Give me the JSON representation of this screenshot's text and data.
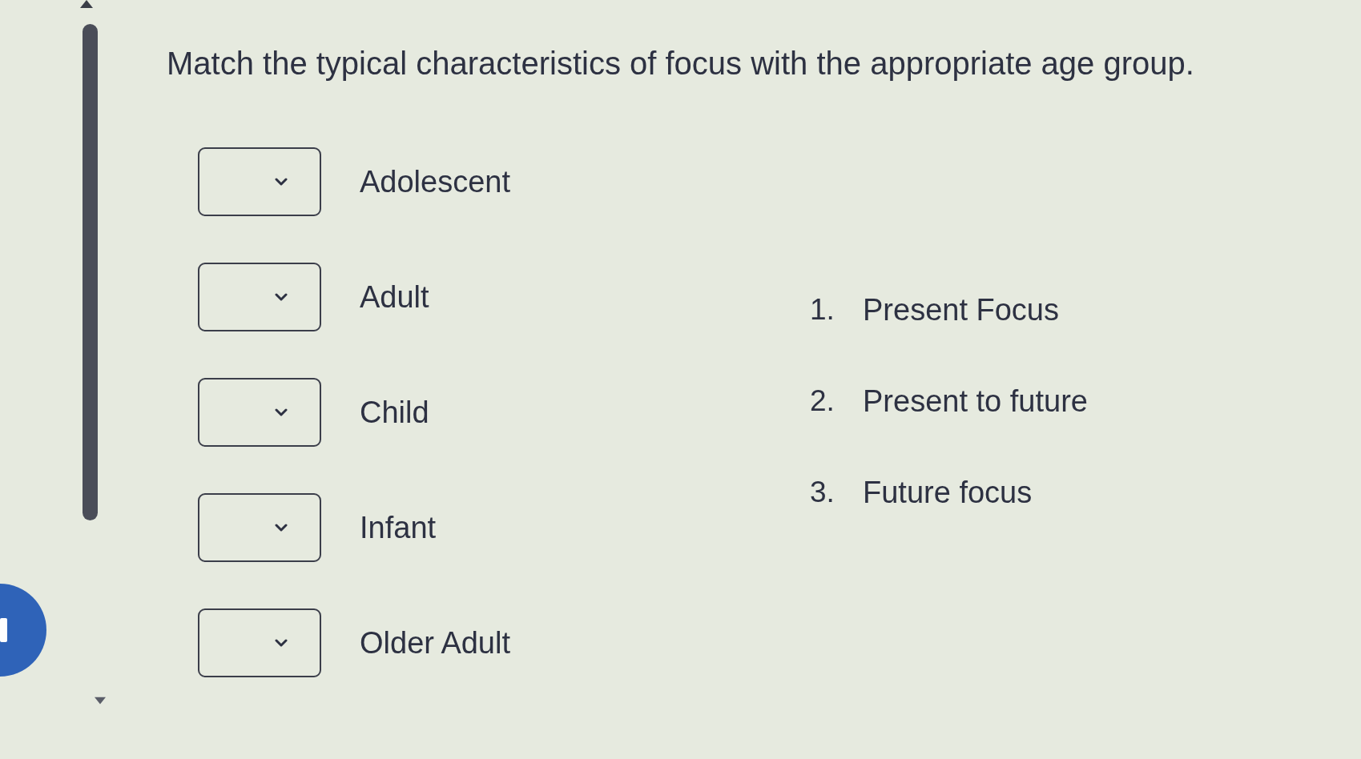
{
  "question": {
    "title": "Match the typical characteristics of focus with the appropriate age group."
  },
  "prompts": [
    {
      "label": "Adolescent"
    },
    {
      "label": "Adult"
    },
    {
      "label": "Child"
    },
    {
      "label": "Infant"
    },
    {
      "label": "Older Adult"
    }
  ],
  "answers": [
    {
      "number": "1.",
      "text": "Present Focus"
    },
    {
      "number": "2.",
      "text": "Present to future"
    },
    {
      "number": "3.",
      "text": "Future focus"
    }
  ]
}
